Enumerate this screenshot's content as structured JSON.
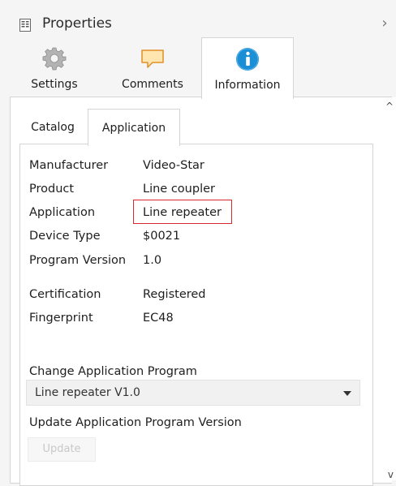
{
  "panel": {
    "title": "Properties",
    "icon": "properties-icon",
    "collapse_glyph": "›"
  },
  "main_tabs": [
    {
      "label": "Settings",
      "icon": "gear-icon",
      "active": false
    },
    {
      "label": "Comments",
      "icon": "comment-icon",
      "active": false
    },
    {
      "label": "Information",
      "icon": "info-icon",
      "active": true
    }
  ],
  "sub_tabs": [
    {
      "label": "Catalog",
      "active": false
    },
    {
      "label": "Application",
      "active": true
    }
  ],
  "properties": [
    {
      "label": "Manufacturer",
      "value": "Video-Star"
    },
    {
      "label": "Product",
      "value": "Line coupler"
    },
    {
      "label": "Application",
      "value": "Line repeater",
      "highlighted": true
    },
    {
      "label": "Device Type",
      "value": "$0021"
    },
    {
      "label": "Program Version",
      "value": "1.0"
    },
    {
      "label": "Certification",
      "value": "Registered"
    },
    {
      "label": "Fingerprint",
      "value": "EC48"
    }
  ],
  "change_program": {
    "title": "Change Application Program",
    "selected_value": "Line repeater V1.0"
  },
  "update_version": {
    "title": "Update Application Program Version",
    "button_label": "Update",
    "button_enabled": false
  },
  "colors": {
    "highlight_border": "#d6282d",
    "info_icon": "#1a8fd6",
    "comment_icon": "#f2a433",
    "gear_icon": "#a8a8a8"
  }
}
